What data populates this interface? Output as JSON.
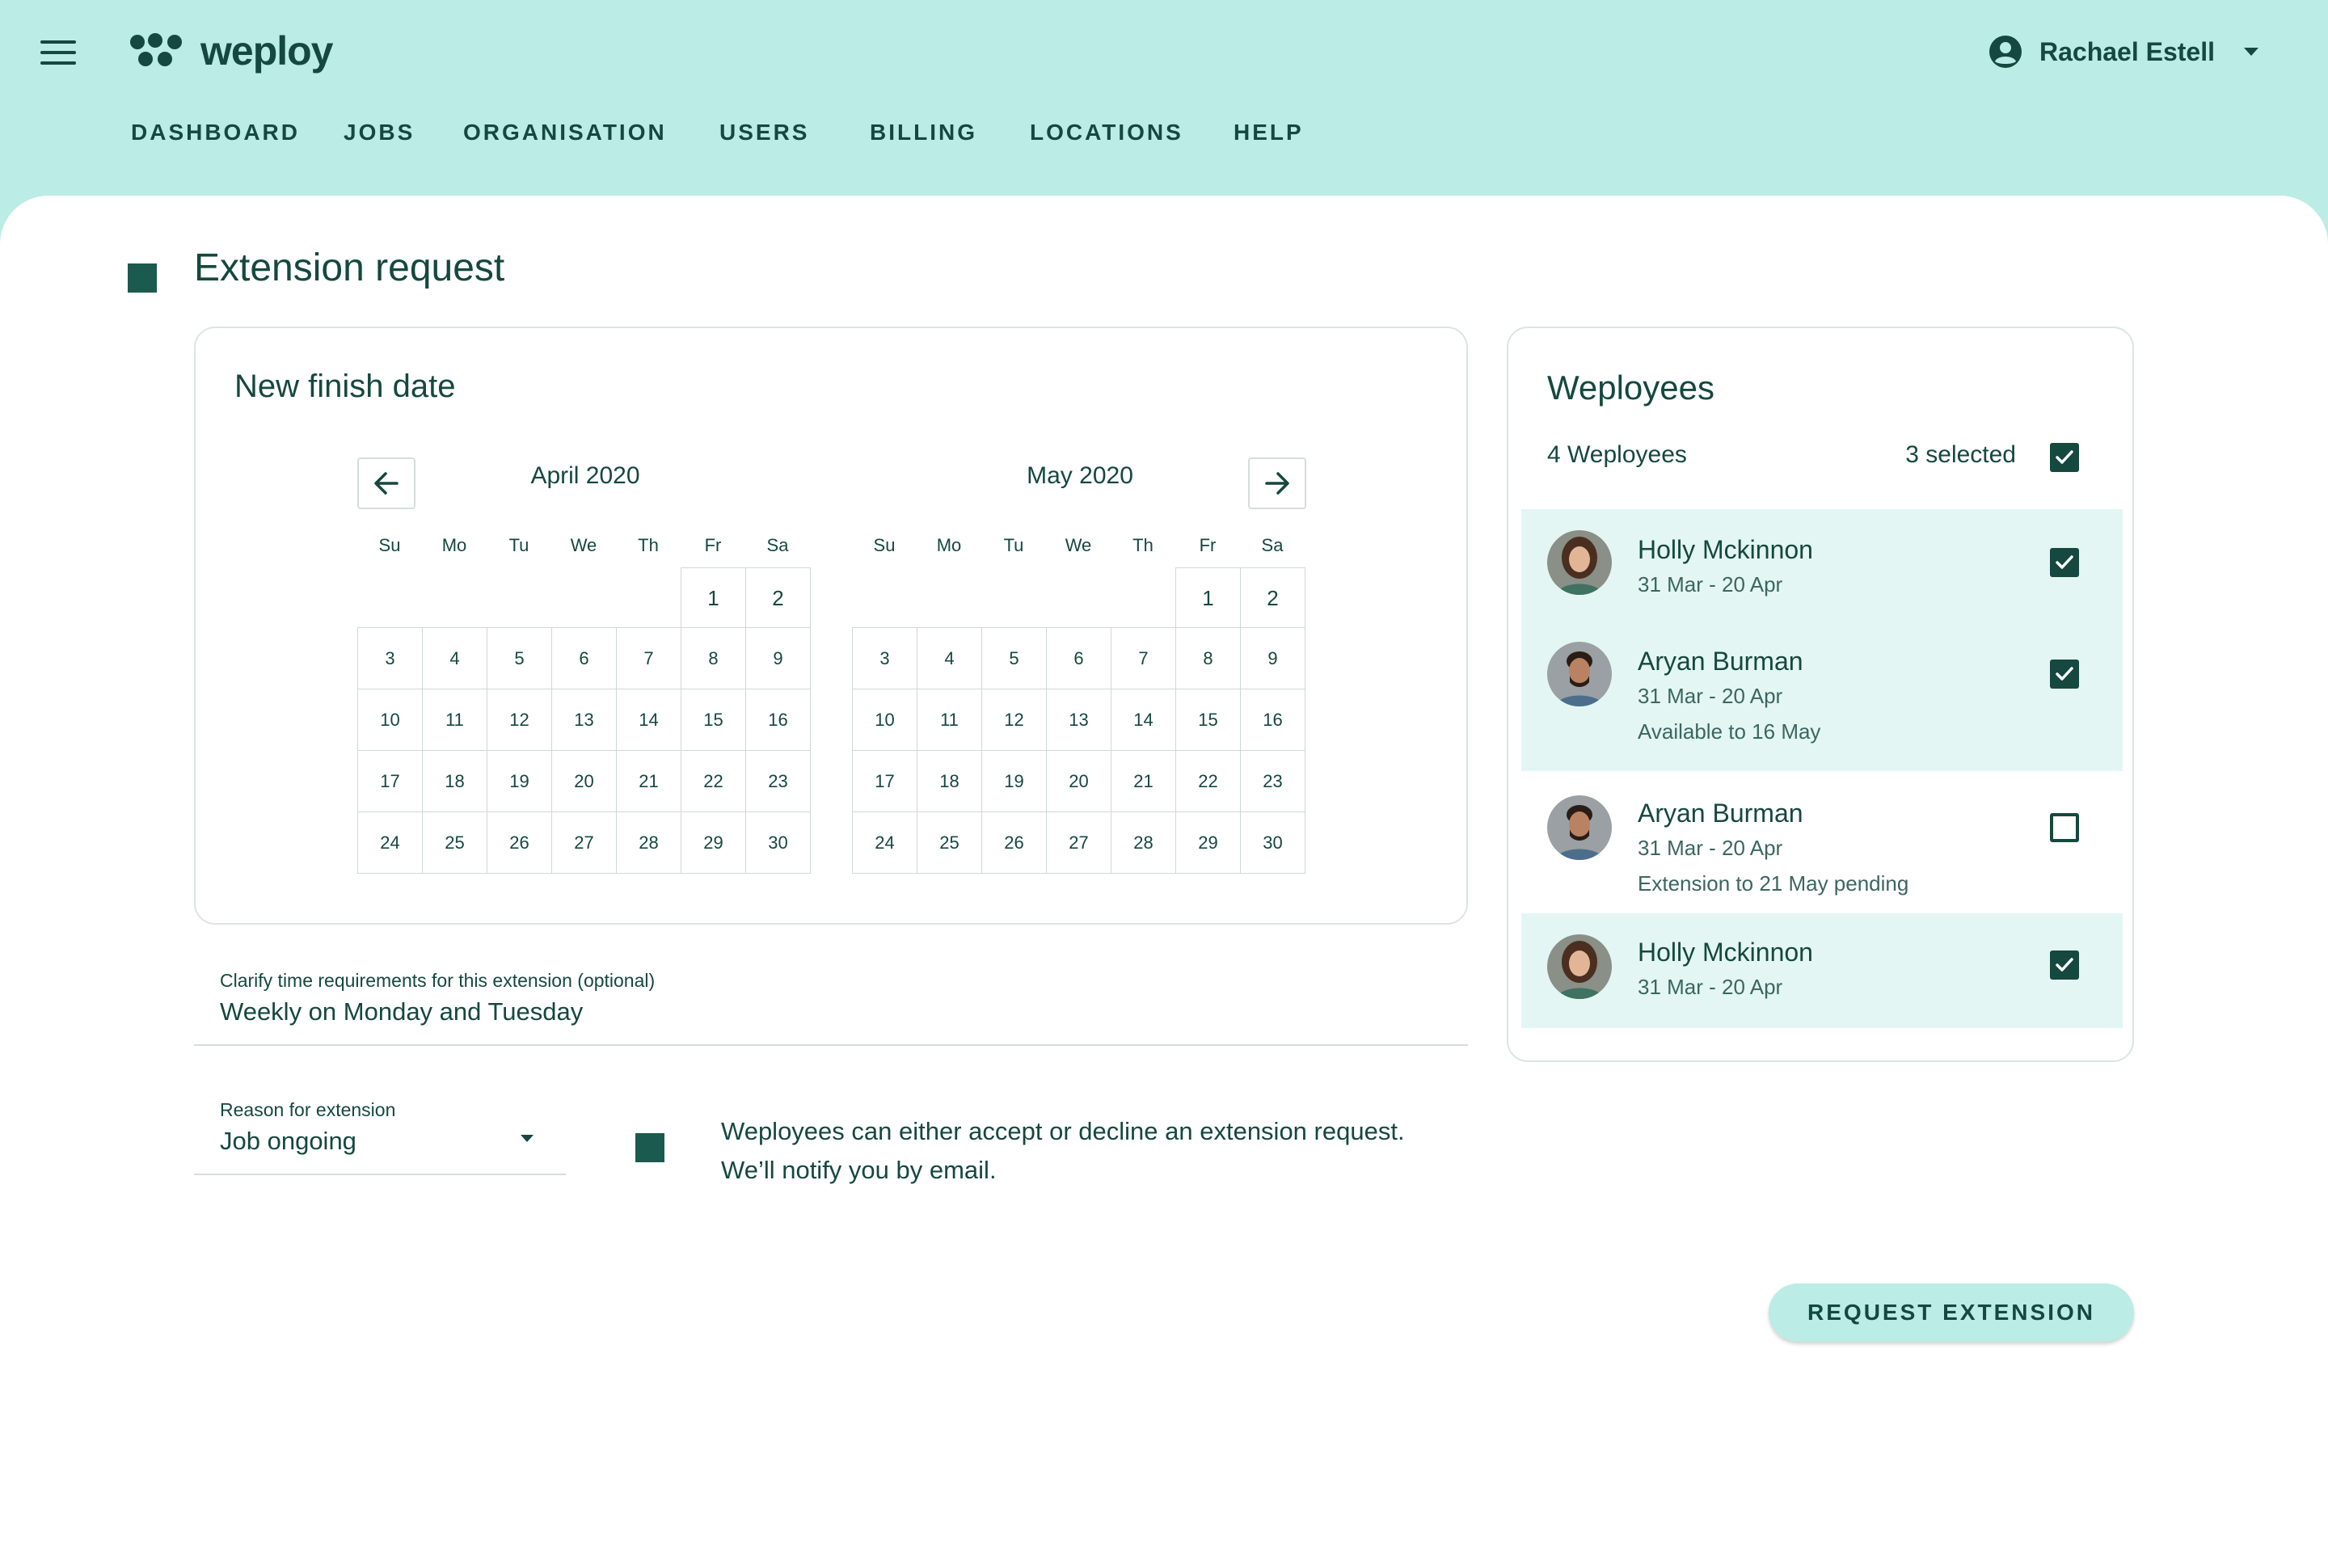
{
  "app": {
    "brand": "weploy"
  },
  "user": {
    "name": "Rachael Estell"
  },
  "nav": [
    "DASHBOARD",
    "JOBS",
    "ORGANISATION",
    "USERS",
    "BILLING",
    "LOCATIONS",
    "HELP"
  ],
  "page": {
    "title": "Extension request"
  },
  "calendar": {
    "card_title": "New finish date",
    "weekdays": [
      "Su",
      "Mo",
      "Tu",
      "We",
      "Th",
      "Fr",
      "Sa"
    ],
    "months": [
      {
        "title": "April 2020",
        "weeks": [
          [
            "",
            "",
            "",
            "",
            "",
            "1",
            "2"
          ],
          [
            "3",
            "4",
            "5",
            "6",
            "7",
            "8",
            "9"
          ],
          [
            "10",
            "11",
            "12",
            "13",
            "14",
            "15",
            "16"
          ],
          [
            "17",
            "18",
            "19",
            "20",
            "21",
            "22",
            "23"
          ],
          [
            "24",
            "25",
            "26",
            "27",
            "28",
            "29",
            "30"
          ]
        ]
      },
      {
        "title": "May 2020",
        "weeks": [
          [
            "",
            "",
            "",
            "",
            "",
            "1",
            "2"
          ],
          [
            "3",
            "4",
            "5",
            "6",
            "7",
            "8",
            "9"
          ],
          [
            "10",
            "11",
            "12",
            "13",
            "14",
            "15",
            "16"
          ],
          [
            "17",
            "18",
            "19",
            "20",
            "21",
            "22",
            "23"
          ],
          [
            "24",
            "25",
            "26",
            "27",
            "28",
            "29",
            "30"
          ]
        ]
      }
    ]
  },
  "time_requirements": {
    "label": "Clarify time requirements for this extension (optional)",
    "value": "Weekly on Monday and Tuesday"
  },
  "reason": {
    "label": "Reason for extension",
    "value": "Job ongoing"
  },
  "info": {
    "line1": "Weployees can either accept or decline an extension request.",
    "line2": "We’ll notify you by  email."
  },
  "weployees": {
    "title": "Weployees",
    "count_label": "4 Weployees",
    "selected_label": "3 selected",
    "select_all_checked": true,
    "items": [
      {
        "name": "Holly Mckinnon",
        "dates": "31 Mar - 20 Apr",
        "note": "",
        "checked": true
      },
      {
        "name": "Aryan Burman",
        "dates": "31 Mar - 20 Apr",
        "note": "Available to 16 May",
        "checked": true
      },
      {
        "name": "Aryan Burman",
        "dates": "31 Mar - 20 Apr",
        "note": "Extension to 21 May pending",
        "checked": false
      },
      {
        "name": "Holly Mckinnon",
        "dates": "31 Mar - 20 Apr",
        "note": "",
        "checked": true
      }
    ]
  },
  "actions": {
    "request_label": "REQUEST EXTENSION"
  },
  "colors": {
    "mint": "#bbece6",
    "dark_teal": "#15483f",
    "selected_row": "#e3f6f3"
  }
}
